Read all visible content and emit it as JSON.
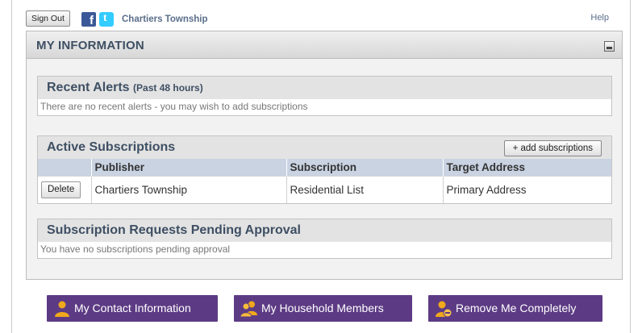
{
  "topbar": {
    "sign_out_label": "Sign Out",
    "facebook_glyph": "f",
    "twitter_glyph": "t",
    "org_name": "Chartiers Township",
    "help_label": "Help"
  },
  "panel": {
    "title": "MY INFORMATION"
  },
  "recent_alerts": {
    "title": "Recent Alerts",
    "subtitle": "(Past 48 hours)",
    "message": "There are no recent alerts - you may wish to add subscriptions"
  },
  "active_subscriptions": {
    "title": "Active Subscriptions",
    "add_label": "+ add subscriptions",
    "columns": [
      "",
      "Publisher",
      "Subscription",
      "Target Address"
    ],
    "rows": [
      {
        "action_label": "Delete",
        "publisher": "Chartiers Township",
        "subscription": "Residential List",
        "target_address": "Primary Address"
      }
    ]
  },
  "pending": {
    "title": "Subscription Requests Pending Approval",
    "message": "You have no subscriptions pending approval"
  },
  "actions": {
    "contact_label": "My Contact Information",
    "household_label": "My Household Members",
    "remove_label": "Remove Me Completely"
  },
  "colors": {
    "accent_purple": "#5d3b84",
    "icon_orange": "#f0a81c",
    "heading_blue": "#3e4f63",
    "table_header": "#c9d3e2",
    "facebook": "#3b5998",
    "twitter": "#33ccff"
  },
  "icons": {
    "contact": "person-icon",
    "household": "people-icon",
    "remove": "person-remove-icon",
    "collapse": "minimize-icon"
  }
}
